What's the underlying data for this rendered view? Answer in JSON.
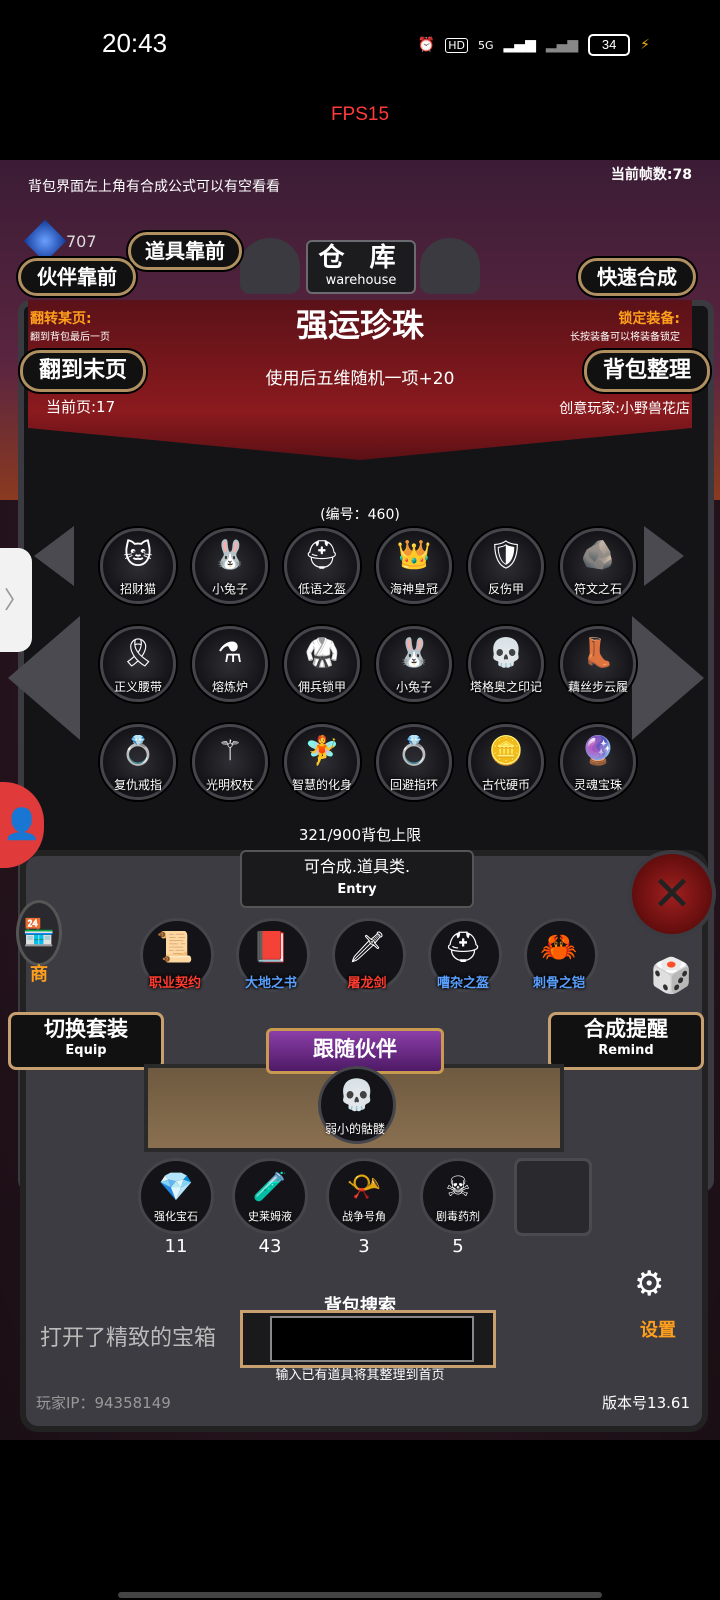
{
  "status_bar": {
    "time": "20:43",
    "network": "5G",
    "battery": "34",
    "icons": [
      "alarm-icon",
      "hd-icon",
      "signal-icon",
      "signal-icon-2",
      "charging-icon"
    ]
  },
  "fps_overlay": "FPS15",
  "hint_top": "背包界面左上角有合成公式可以有空看看",
  "fps_count": "当前帧数:78",
  "gem_count": "707",
  "title": {
    "cn": "仓 库",
    "en": "warehouse"
  },
  "buttons": {
    "prop_front": "道具靠前",
    "partner_front": "伙伴靠前",
    "quick_craft": "快速合成",
    "last_page": "翻到末页",
    "sort_bag": "背包整理",
    "switch_set": "切换套装",
    "switch_set_en": "Equip",
    "craft_remind": "合成提醒",
    "craft_remind_en": "Remind"
  },
  "flip_page": {
    "title": "翻转某页:",
    "sub": "翻到背包最后一页"
  },
  "lock_equip": {
    "title": "锁定装备:",
    "sub": "长按装备可以将装备锁定"
  },
  "item": {
    "name": "强运珍珠",
    "desc": "使用后五维随机一项+20",
    "id": "(编号：460)"
  },
  "current_page": "当前页:17",
  "creator": "创意玩家:小野兽花店",
  "grid": [
    {
      "label": "招财猫",
      "glyph": "🐱"
    },
    {
      "label": "小兔子",
      "glyph": "🐰"
    },
    {
      "label": "低语之盔",
      "glyph": "⛑"
    },
    {
      "label": "海神皇冠",
      "glyph": "👑"
    },
    {
      "label": "反伤甲",
      "glyph": "🛡"
    },
    {
      "label": "符文之石",
      "glyph": "🪨"
    },
    {
      "label": "正义腰带",
      "glyph": "🎗"
    },
    {
      "label": "熔炼炉",
      "glyph": "⚗"
    },
    {
      "label": "佣兵锁甲",
      "glyph": "🥋"
    },
    {
      "label": "小兔子",
      "glyph": "🐰"
    },
    {
      "label": "塔格奥之印记",
      "glyph": "💀"
    },
    {
      "label": "藕丝步云履",
      "glyph": "👢"
    },
    {
      "label": "复仇戒指",
      "glyph": "💍"
    },
    {
      "label": "光明权杖",
      "glyph": "⚚"
    },
    {
      "label": "智慧的化身",
      "glyph": "🧚"
    },
    {
      "label": "回避指环",
      "glyph": "💍"
    },
    {
      "label": "古代硬币",
      "glyph": "🪙"
    },
    {
      "label": "灵魂宝珠",
      "glyph": "🔮"
    }
  ],
  "bag_limit": "321/900背包上限",
  "entry": {
    "text": "可合成.道具类.",
    "en": "Entry"
  },
  "recipes": [
    {
      "label": "职业契约",
      "glyph": "📜",
      "color": "#ff3b2f"
    },
    {
      "label": "大地之书",
      "glyph": "📕",
      "color": "#5aa0ff"
    },
    {
      "label": "屠龙剑",
      "glyph": "🗡",
      "color": "#ff3b2f"
    },
    {
      "label": "嘈杂之盔",
      "glyph": "⛑",
      "color": "#5aa0ff"
    },
    {
      "label": "刺骨之铠",
      "glyph": "🦀",
      "color": "#5aa0ff"
    }
  ],
  "follow": {
    "title": "跟随伙伴",
    "companion": "弱小的骷髅",
    "glyph": "💀"
  },
  "quick_items": [
    {
      "label": "强化宝石",
      "count": "11",
      "glyph": "💎"
    },
    {
      "label": "史莱姆液",
      "count": "43",
      "glyph": "🧪"
    },
    {
      "label": "战争号角",
      "count": "3",
      "glyph": "📯"
    },
    {
      "label": "剧毒药剂",
      "count": "5",
      "glyph": "☠"
    }
  ],
  "side_labels": {
    "shop": "商",
    "settings": "设置"
  },
  "search": {
    "label": "背包搜索",
    "hint": "输入已有道具将其整理到首页",
    "value": ""
  },
  "log_text": "打开了精致的宝箱",
  "player_ip": "玩家IP：94358149",
  "version": "版本号13.61",
  "colors": {
    "accent_orange": "#ff9f1c",
    "banner_red": "#8b1a1e",
    "fps_red": "#ff3b3b"
  }
}
